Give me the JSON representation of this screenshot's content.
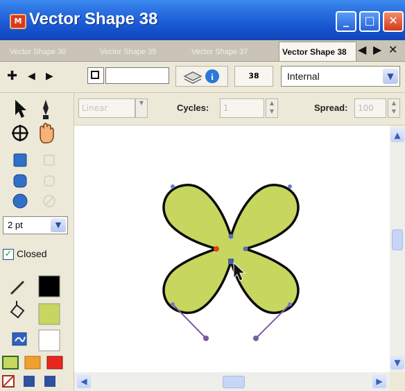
{
  "window": {
    "title": "Vector Shape 38",
    "title_icon_text": "M"
  },
  "tabs": [
    {
      "label": "Vector Shape 30",
      "active": false
    },
    {
      "label": "Vector Shape 35",
      "active": false
    },
    {
      "label": "Vector Shape 37",
      "active": false
    },
    {
      "label": "Vector Shape 38",
      "active": true
    }
  ],
  "toolbar": {
    "shape_number": "38",
    "select_value": "Internal",
    "name_field": ""
  },
  "options": {
    "mode_value": "Linear",
    "cycles_label": "Cycles:",
    "cycles_value": "1",
    "spread_label": "Spread:",
    "spread_value": "100"
  },
  "tools": {
    "stroke_width": "2 pt",
    "closed_label": "Closed",
    "closed_checked": true
  },
  "colors": {
    "fill": "#c6d65e",
    "stroke": "#000000",
    "handle": "#7b5aa8",
    "selected_point": "#e0401c",
    "point": "#5a6fb8"
  }
}
